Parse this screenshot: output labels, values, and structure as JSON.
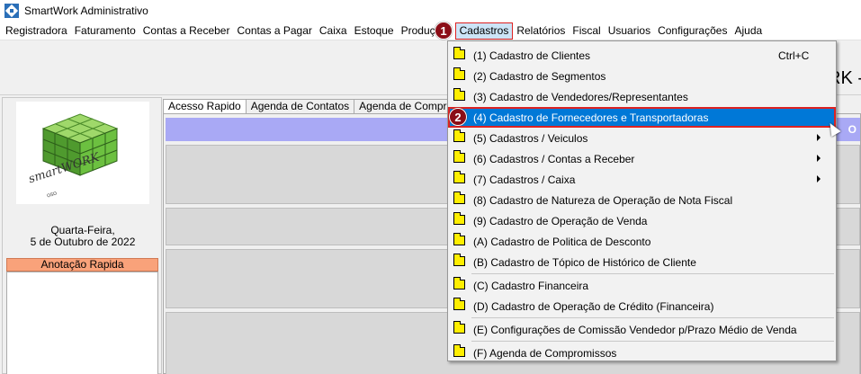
{
  "window": {
    "title": "SmartWork Administrativo"
  },
  "menubar": {
    "items": [
      {
        "label": "Registradora"
      },
      {
        "label": "Faturamento"
      },
      {
        "label": "Contas a Receber"
      },
      {
        "label": "Contas a Pagar"
      },
      {
        "label": "Caixa"
      },
      {
        "label": "Estoque"
      },
      {
        "label": "Produç"
      },
      {
        "label": "Cadastros"
      },
      {
        "label": "Relatórios"
      },
      {
        "label": "Fiscal"
      },
      {
        "label": "Usuarios"
      },
      {
        "label": "Configurações"
      },
      {
        "label": "Ajuda"
      }
    ]
  },
  "background_title": "RK -",
  "left_panel": {
    "logo_text": "smartWORK",
    "logo_sub": "oso",
    "date_weekday": "Quarta-Feira,",
    "date_full": "5 de Outubro de 2022",
    "anotacao_label": "Anotação Rapida"
  },
  "tabs": [
    {
      "label": "Acesso Rapido"
    },
    {
      "label": "Agenda de Contatos"
    },
    {
      "label": "Agenda de Comprom"
    }
  ],
  "content": {
    "purple_label": "O"
  },
  "dropdown": {
    "items": [
      {
        "label": "(1) Cadastro de Clientes",
        "shortcut": "Ctrl+C"
      },
      {
        "label": "(2) Cadastro de Segmentos"
      },
      {
        "label": "(3) Cadastro de Vendedores/Representantes"
      },
      {
        "label": "(4) Cadastro de Fornecedores e Transportadoras"
      },
      {
        "label": "(5) Cadastros / Veiculos"
      },
      {
        "label": "(6) Cadastros / Contas a Receber"
      },
      {
        "label": "(7) Cadastros / Caixa"
      },
      {
        "label": "(8) Cadastro de Natureza de Operação de Nota Fiscal"
      },
      {
        "label": "(9) Cadastro de Operação de Venda"
      },
      {
        "label": "(A) Cadastro de Politica de Desconto"
      },
      {
        "label": "(B) Cadastro de Tópico de Histórico de Cliente"
      },
      {
        "label": "(C) Cadastro Financeira"
      },
      {
        "label": "(D) Cadastro de Operação de Crédito (Financeira)"
      },
      {
        "label": "(E) Configurações de Comissão Vendedor p/Prazo Médio de Venda"
      },
      {
        "label": "(F) Agenda de Compromissos"
      }
    ]
  },
  "annotations": {
    "badge1": "1",
    "badge2": "2"
  },
  "colors": {
    "highlight": "#0078d7",
    "badge": "#8b0e17",
    "annotation_border": "#dd2222",
    "purple_bar": "#a9a9f5",
    "anotacao_header": "#f9a27a"
  }
}
